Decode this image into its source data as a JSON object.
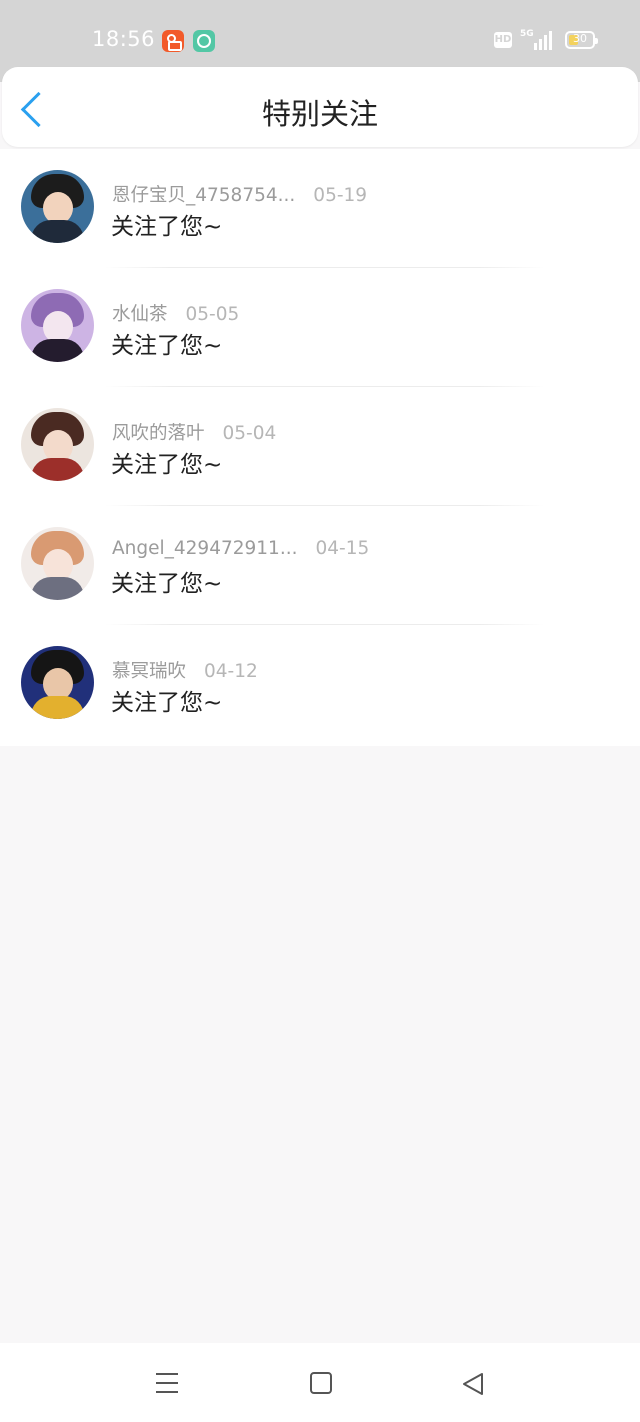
{
  "status_bar": {
    "time": "18:56",
    "network": "5G",
    "hd_badge": "HD",
    "battery": "30",
    "icons": [
      "app-icon-orange",
      "app-icon-green-upload",
      "hd-icon",
      "signal-icon",
      "battery-icon"
    ]
  },
  "header": {
    "title": "特别关注",
    "back_icon": "chevron-left-icon",
    "accent_color": "#2aa0ef"
  },
  "notifications": [
    {
      "name": "恩仔宝贝_4758754...",
      "date": "05-19",
      "message": "关注了您~"
    },
    {
      "name": "水仙茶",
      "date": "05-05",
      "message": "关注了您~"
    },
    {
      "name": "风吹的落叶",
      "date": "05-04",
      "message": "关注了您~"
    },
    {
      "name": "Angel_429472911...",
      "date": "04-15",
      "message": "关注了您~"
    },
    {
      "name": "慕冥瑞吹",
      "date": "04-12",
      "message": "关注了您~"
    }
  ],
  "nav_bar": {
    "icons": [
      "menu-icon",
      "home-icon",
      "back-triangle-icon"
    ]
  }
}
